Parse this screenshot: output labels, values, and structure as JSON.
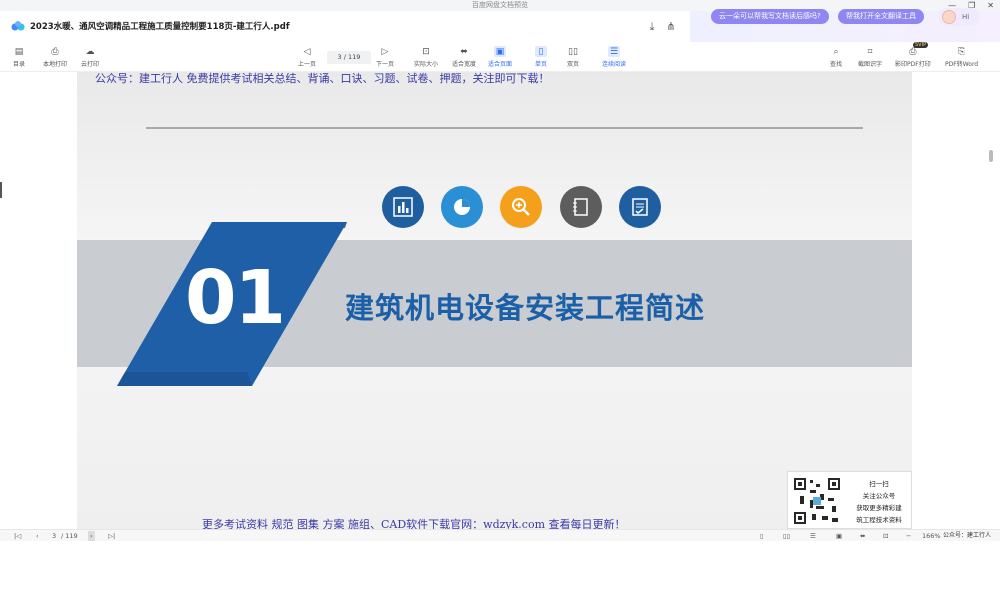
{
  "window": {
    "title": "百度网盘文档预览"
  },
  "titlebar": {
    "doc_title": "2023水暖、通风空调精品工程施工质量控制要118页-建工行人.pdf"
  },
  "ai": {
    "pill1": "云一朵可以帮我写文档读后感吗?",
    "pill2": "帮我打开全文翻译工具",
    "hi": "Hi"
  },
  "toolbar": {
    "catalog": "目录",
    "local_print": "本地打印",
    "cloud_print": "云打印",
    "prev": "上一页",
    "page_value": "3",
    "page_total": "/ 119",
    "next": "下一页",
    "actual_size": "实际大小",
    "fit_width": "适合宽度",
    "fit_page": "适合页面",
    "single": "单页",
    "double": "双页",
    "continuous": "连续阅读",
    "search": "查找",
    "screenshot_ocr": "截图识字",
    "pdf_print": "影印PDF打印",
    "vip": "SVIP",
    "pdf_to_word": "PDF转Word"
  },
  "page": {
    "header_note": "公众号：建工行人 免费提供考试相关总结、背诵、口诀、习题、试卷、押题，关注即可下载！",
    "number": "01",
    "heading": "建筑机电设备安装工程简述",
    "footer_note": "更多考试资料 规范 图集 方案 施组、CAD软件下载官网：wdzyk.com 查看每日更新！",
    "icons": [
      {
        "name": "bar-chart-icon",
        "color": "#1f5fa0"
      },
      {
        "name": "pie-chart-icon",
        "color": "#2b8fd6"
      },
      {
        "name": "magnifier-icon",
        "color": "#f5a01c"
      },
      {
        "name": "notebook-icon",
        "color": "#5d5d5d"
      },
      {
        "name": "checklist-icon",
        "color": "#1f5fa0"
      }
    ]
  },
  "qrcard": {
    "line1": "扫一扫",
    "line2": "关注公众号",
    "line3": "获取更多精彩建",
    "line4": "筑工程技术资料"
  },
  "bottombar": {
    "page_value": "3",
    "page_total": "/ 119",
    "zoom": "166%"
  },
  "watermark": "公众号：建工行人"
}
